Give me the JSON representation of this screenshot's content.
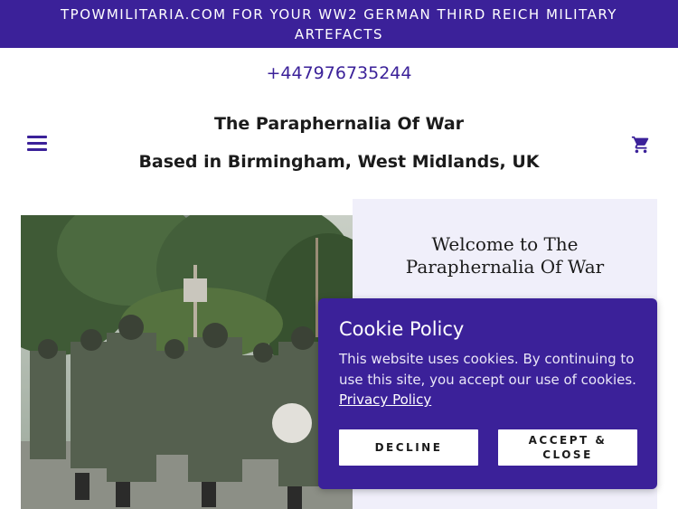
{
  "announcement": {
    "text": "TPOWMILITARIA.COM FOR YOUR WW2 GERMAN THIRD REICH MILITARY ARTEFACTS"
  },
  "header": {
    "phone": "+447976735244",
    "title": "The Paraphernalia Of War",
    "tagline": "Based in Birmingham, West Midlands, UK",
    "menu_icon": "hamburger-menu-icon",
    "cart_icon": "shopping-cart-icon"
  },
  "hero": {
    "image": "colour photo of soldiers marching in a parade with a drum and standard",
    "welcome_heading": "Welcome to The Paraphernalia Of War"
  },
  "cookie": {
    "title": "Cookie Policy",
    "body": "This website uses cookies. By continuing to use this site, you accept our use of cookies.",
    "link": "Privacy Policy",
    "decline_label": "DECLINE",
    "accept_label": "ACCEPT & CLOSE"
  },
  "colors": {
    "brand_purple": "#3b2199",
    "panel_bg": "#f0effa",
    "text_dark": "#1b1b1b"
  }
}
